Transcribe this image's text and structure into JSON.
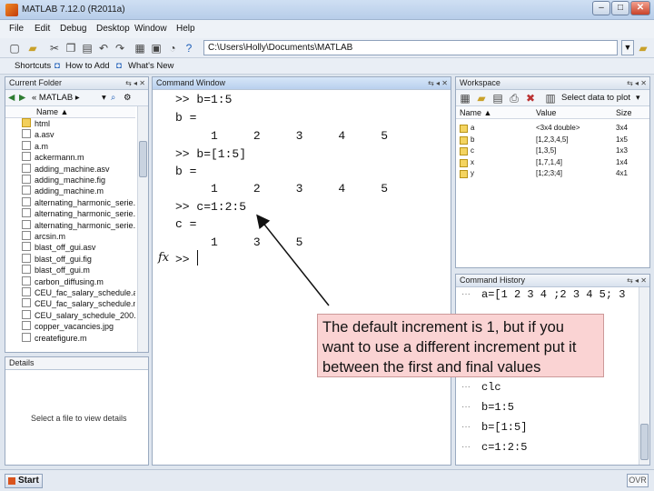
{
  "window": {
    "title": "MATLAB 7.12.0 (R2011a)",
    "minimize": "–",
    "maximize": "□",
    "close": "✕"
  },
  "menu": [
    "File",
    "Edit",
    "Debug",
    "Desktop",
    "Window",
    "Help"
  ],
  "toolbar": {
    "current_folder_label": "Current Folder:",
    "path": "C:\\Users\\Holly\\Documents\\MATLAB",
    "path_dropdown": "▼",
    "browse": "..."
  },
  "shortcuts": {
    "label": "Shortcuts",
    "how_to_add": "How to Add",
    "whats_new": "What's New"
  },
  "current_folder": {
    "title": "Current Folder",
    "nav_path": "« MATLAB ▸",
    "column_name": "Name ▲",
    "files": [
      "html",
      "a.asv",
      "a.m",
      "ackermann.m",
      "adding_machine.asv",
      "adding_machine.fig",
      "adding_machine.m",
      "alternating_harmonic_serie...",
      "alternating_harmonic_serie...",
      "alternating_harmonic_serie...",
      "arcsin.m",
      "blast_off_gui.asv",
      "blast_off_gui.fig",
      "blast_off_gui.m",
      "carbon_diffusing.m",
      "CEU_fac_salary_schedule.asv",
      "CEU_fac_salary_schedule.m",
      "CEU_salary_schedule_200...",
      "copper_vacancies.jpg",
      "createfigure.m"
    ]
  },
  "details": {
    "title": "Details",
    "placeholder": "Select a file to view details"
  },
  "command_window": {
    "title": "Command Window",
    "lines": [
      ">> b=1:5",
      "b =",
      "     1     2     3     4     5",
      ">> b=[1:5]",
      "b =",
      "     1     2     3     4     5",
      ">> c=1:2:5",
      "c =",
      "     1     3     5"
    ],
    "fx": "fx",
    "prompt": ">>"
  },
  "workspace": {
    "title": "Workspace",
    "plot_select": "Select data to plot",
    "columns": [
      "Name ▲",
      "Value",
      "Size"
    ],
    "rows": [
      {
        "name": "a",
        "value": "<3x4 double>",
        "size": "3x4"
      },
      {
        "name": "b",
        "value": "[1,2,3,4,5]",
        "size": "1x5"
      },
      {
        "name": "c",
        "value": "[1,3,5]",
        "size": "1x3"
      },
      {
        "name": "x",
        "value": "[1,7,1,4]",
        "size": "1x4"
      },
      {
        "name": "y",
        "value": "[1;2;3;4]",
        "size": "4x1"
      }
    ]
  },
  "command_history": {
    "title": "Command History",
    "lines": [
      "a=[1 2 3 4 ;2 3 4 5; 3",
      "clc",
      "clc",
      "b=1:5",
      "b=[1:5]",
      "c=1:2:5"
    ]
  },
  "status": {
    "start": "Start",
    "ovr": "OVR"
  },
  "annotation": {
    "text": "The default increment is 1, but if you want to use a different increment put it between the first and final values",
    "background": "#fad3d3"
  }
}
